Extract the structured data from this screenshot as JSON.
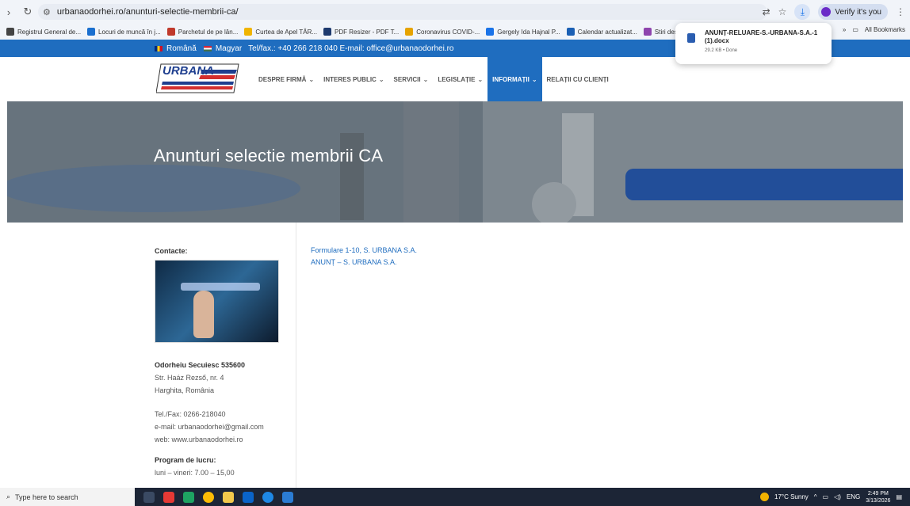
{
  "browser": {
    "url": "urbanaodorhei.ro/anunturi-selectie-membrii-ca/",
    "verify_label": "Verify it's you",
    "bookmarks": [
      {
        "label": "Registrul General de...",
        "color": "#444444"
      },
      {
        "label": "Locuri de muncă în j...",
        "color": "#1a6fcf"
      },
      {
        "label": "Parchetul de pe lân...",
        "color": "#c0392b"
      },
      {
        "label": "Curtea de Apel TÂR...",
        "color": "#f0b400"
      },
      {
        "label": "PDF Resizer - PDF T...",
        "color": "#1e3a6e"
      },
      {
        "label": "Coronavirus COVID-...",
        "color": "#e6a300"
      },
      {
        "label": "Gergely Ida Hajnal P...",
        "color": "#1a73e8"
      },
      {
        "label": "Calendar actualizat...",
        "color": "#1a5fb4"
      },
      {
        "label": "Stiri despre evaluare...",
        "color": "#8e44ad"
      }
    ],
    "all_bookmarks": "All Bookmarks",
    "more_bookmarks": "»"
  },
  "download": {
    "filename": "ANUNȚ-RELUARE-S.-URBANA-S.A.-1 (1).docx",
    "meta": "29.2 KB • Done"
  },
  "topstrip": {
    "lang_ro": "Română",
    "lang_hu": "Magyar",
    "contact": "Tel/fax.: +40 266 218 040  E-mail: office@urbanaodorhei.ro"
  },
  "header": {
    "logo_text": "URBANA",
    "menu": [
      {
        "label": "DESPRE FIRMĂ",
        "dropdown": true,
        "active": false
      },
      {
        "label": "INTERES PUBLIC",
        "dropdown": true,
        "active": false
      },
      {
        "label": "SERVICII",
        "dropdown": true,
        "active": false
      },
      {
        "label": "LEGISLAȚIE",
        "dropdown": true,
        "active": false
      },
      {
        "label": "INFORMAȚII",
        "dropdown": true,
        "active": true
      },
      {
        "label": "RELAȚII CU CLIENȚI",
        "dropdown": false,
        "active": false
      }
    ]
  },
  "hero": {
    "title": "Anunturi selectie membrii CA"
  },
  "sidebar": {
    "heading": "Contacte:",
    "city": "Odorheiu Secuiesc 535600",
    "street": "Str. Haáz Rezső, nr. 4",
    "county": "Harghita, România",
    "tel": "Tel./Fax: 0266-218040",
    "email": "e-mail: urbanaodorhei@gmail.com",
    "web": "web: www.urbanaodorhei.ro",
    "hours_heading": "Program de lucru:",
    "hours": "luni – vineri: 7.00 – 15,00"
  },
  "content": {
    "links": [
      "Formulare 1-10, S. URBANA S.A.",
      "ANUNȚ – S. URBANA S.A."
    ]
  },
  "taskbar": {
    "search_placeholder": "Type here to search",
    "weather": "17°C  Sunny",
    "lang": "ENG",
    "time": "2:49 PM",
    "date": "3/13/2026"
  }
}
